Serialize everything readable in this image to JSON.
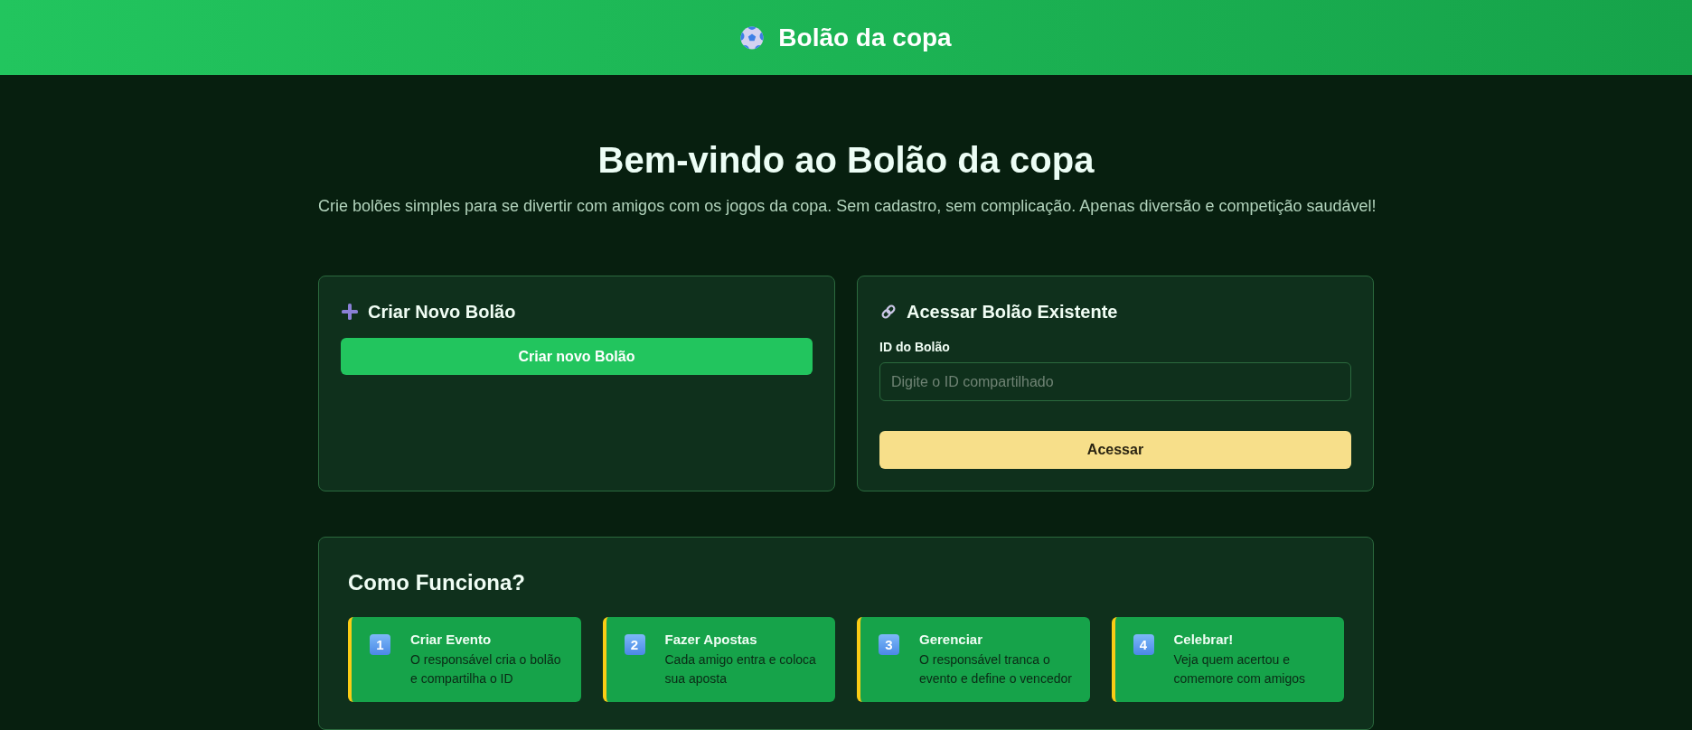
{
  "header": {
    "title": "Bolão da copa"
  },
  "hero": {
    "title": "Bem-vindo ao Bolão da copa",
    "subtitle": "Crie bolões simples para se divertir com amigos com os jogos da copa. Sem cadastro, sem complicação. Apenas diversão e competição saudável!"
  },
  "create_card": {
    "title": "Criar Novo Bolão",
    "button": "Criar novo Bolão"
  },
  "access_card": {
    "title": "Acessar Bolão Existente",
    "field_label": "ID do Bolão",
    "field": {
      "placeholder": "Digite o ID compartilhado"
    },
    "button": "Acessar"
  },
  "how_it_works": {
    "title": "Como Funciona?",
    "steps": [
      {
        "number": "1",
        "title": "Criar Evento",
        "description": "O responsável cria o bolão e compartilha o ID"
      },
      {
        "number": "2",
        "title": "Fazer Apostas",
        "description": "Cada amigo entra e coloca sua aposta"
      },
      {
        "number": "3",
        "title": "Gerenciar",
        "description": "O responsável tranca o evento e define o vencedor"
      },
      {
        "number": "4",
        "title": "Celebrar!",
        "description": "Veja quem acertou e comemore com amigos"
      }
    ]
  }
}
